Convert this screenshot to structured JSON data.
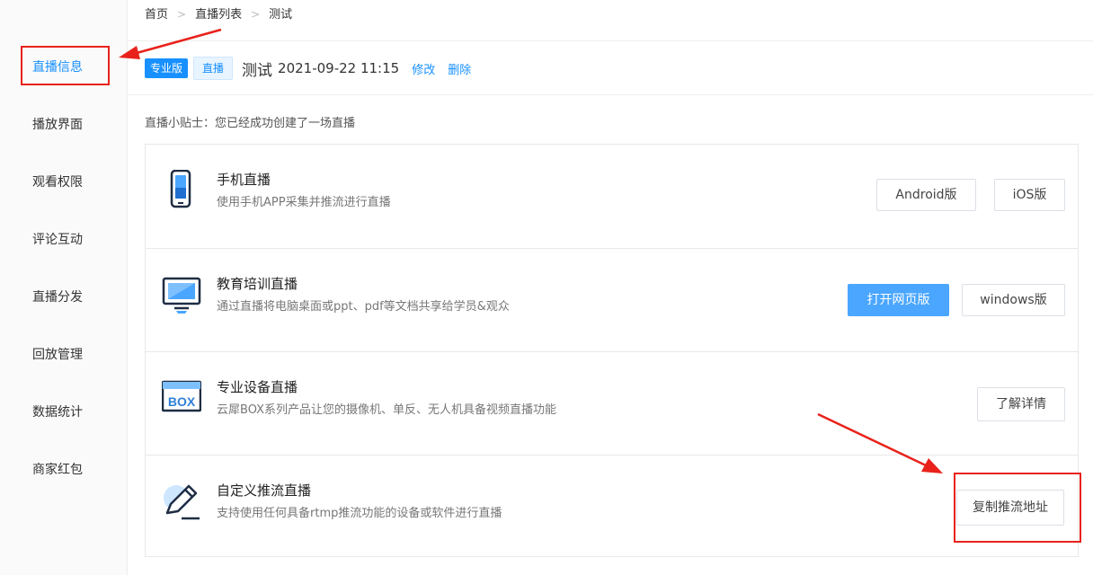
{
  "breadcrumb": [
    "首页",
    "直播列表",
    "测试"
  ],
  "sidebar": {
    "items": [
      {
        "label": "直播信息"
      },
      {
        "label": "播放界面"
      },
      {
        "label": "观看权限"
      },
      {
        "label": "评论互动"
      },
      {
        "label": "直播分发"
      },
      {
        "label": "回放管理"
      },
      {
        "label": "数据统计"
      },
      {
        "label": "商家红包"
      }
    ]
  },
  "header": {
    "badge_pro": "专业版",
    "badge_live": "直播",
    "title": "测试",
    "datetime": "2021-09-22 11:15",
    "edit": "修改",
    "delete": "删除"
  },
  "tips": "直播小贴士：您已经成功创建了一场直播",
  "methods": [
    {
      "icon": "phone-icon",
      "title": "手机直播",
      "desc": "使用手机APP采集并推流进行直播",
      "buttons": [
        "Android版",
        "iOS版"
      ]
    },
    {
      "icon": "monitor-icon",
      "title": "教育培训直播",
      "desc": "通过直播将电脑桌面或ppt、pdf等文档共享给学员&观众",
      "buttons": [
        "打开网页版",
        "windows版"
      ]
    },
    {
      "icon": "box-device-icon",
      "title": "专业设备直播",
      "desc": "云犀BOX系列产品让您的摄像机、单反、无人机具备视频直播功能",
      "box_label": "BOX",
      "buttons": [
        "了解详情"
      ]
    },
    {
      "icon": "pencil-icon",
      "title": "自定义推流直播",
      "desc": "支持使用任何具备rtmp推流功能的设备或软件进行直播",
      "buttons": [
        "复制推流地址"
      ]
    }
  ],
  "colors": {
    "accent": "#1890ff",
    "primary_button": "#4aa6ff",
    "annotation": "#e8221b"
  }
}
